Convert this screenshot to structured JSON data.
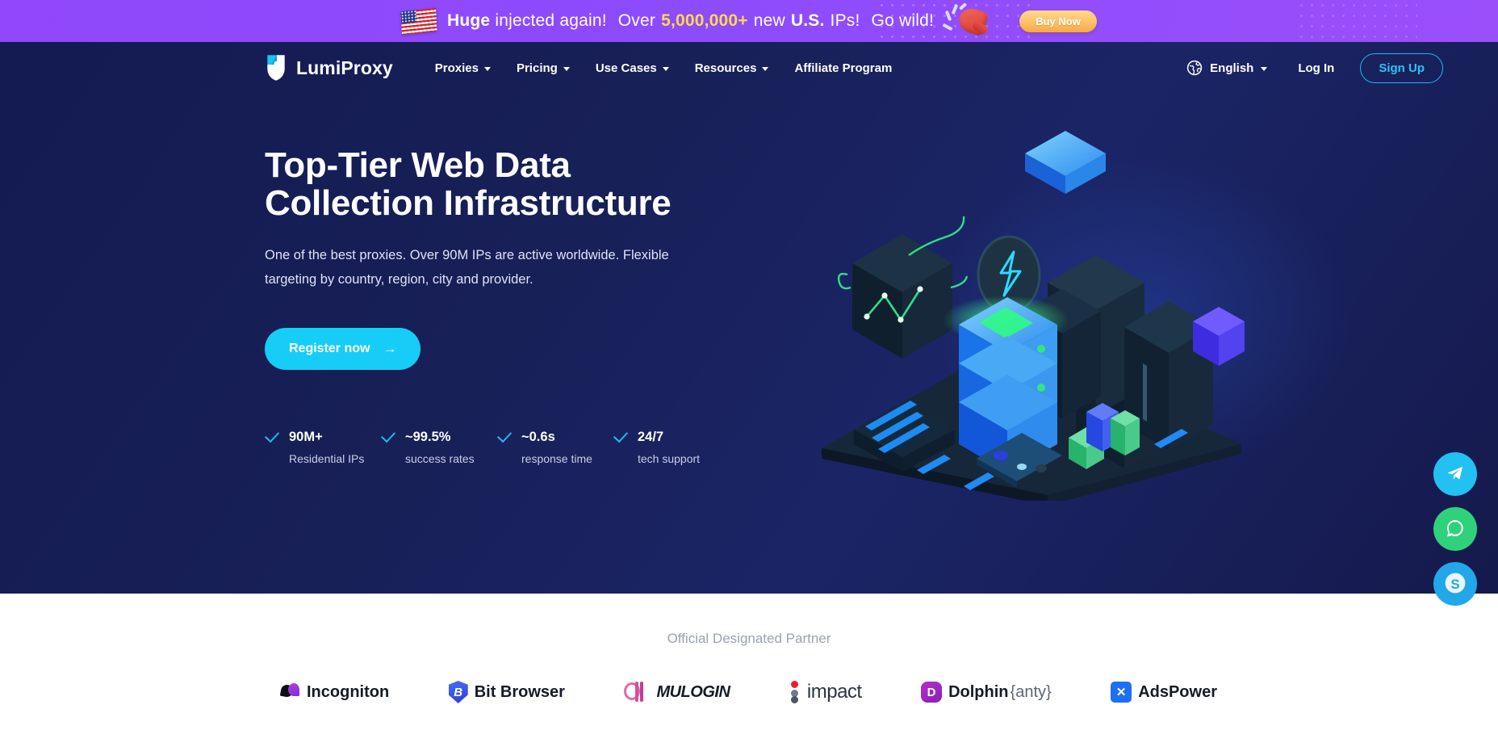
{
  "promo": {
    "icon_flag": "us-flag-icon",
    "text_bold_1": "Huge",
    "text_1": " injected again!",
    "text_2": "Over",
    "amount": "5,000,000+",
    "text_3": "new",
    "text_bold_2": "U.S.",
    "text_4": "IPs!",
    "text_5": "Go wild!",
    "icon_megaphone": "megaphone-icon",
    "buy_label": "Buy Now",
    "bg_color": "#9147fb",
    "amount_color": "#ffd84d",
    "buy_color": "#fcc46b"
  },
  "nav": {
    "brand": "LumiProxy",
    "brand_mark": "lumiproxy-shield-icon",
    "links": [
      {
        "label": "Proxies",
        "has_caret": true
      },
      {
        "label": "Pricing",
        "has_caret": true
      },
      {
        "label": "Use Cases",
        "has_caret": true
      },
      {
        "label": "Resources",
        "has_caret": true
      },
      {
        "label": "Affiliate Program",
        "has_caret": false
      }
    ],
    "language": "English",
    "language_icon": "globe-icon",
    "login_label": "Log In",
    "signup_label": "Sign Up",
    "signup_color": "#2bc4f5"
  },
  "hero": {
    "title_line1": "Top-Tier Web Data",
    "title_line2": "Collection Infrastructure",
    "subtitle": "One of the best proxies. Over 90M IPs are active worldwide. Flexible targeting by country, region, city and provider.",
    "cta_label": "Register now",
    "cta_arrow": "→",
    "cta_color": "#16cdf7",
    "bg_color": "#141a52",
    "illustration": "isometric-server-datacenter-illustration",
    "stats": [
      {
        "value": "90M+",
        "label": "Residential IPs",
        "icon": "check-icon"
      },
      {
        "value": "~99.5%",
        "label": "success rates",
        "icon": "check-icon"
      },
      {
        "value": "~0.6s",
        "label": "response time",
        "icon": "check-icon"
      },
      {
        "value": "24/7",
        "label": "tech support",
        "icon": "check-icon"
      }
    ]
  },
  "partners": {
    "title": "Official Designated Partner",
    "items": [
      {
        "name": "Incogniton",
        "mark": "incogniton-logo-icon"
      },
      {
        "name": "Bit Browser",
        "mark": "bit-browser-logo-icon"
      },
      {
        "name": "MULOGIN",
        "mark": "mulogin-logo-icon"
      },
      {
        "name": "impact",
        "mark": "impact-logo-icon"
      },
      {
        "name": "Dolphin",
        "name_suffix": "{anty}",
        "mark": "dolphin-anty-logo-icon"
      },
      {
        "name": "AdsPower",
        "mark": "adspower-logo-icon"
      }
    ]
  },
  "social": [
    {
      "name": "telegram",
      "color": "#23c0f2"
    },
    {
      "name": "whatsapp",
      "color": "#2fd27a"
    },
    {
      "name": "skype",
      "color": "#22a7e8"
    }
  ]
}
